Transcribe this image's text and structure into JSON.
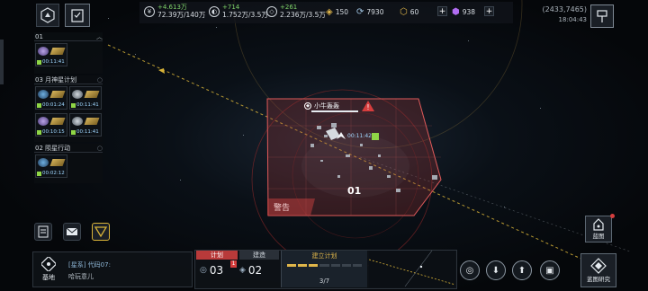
{
  "resources": {
    "credits": {
      "delta": "+4.613万",
      "value": "72.39万/140万"
    },
    "metal": {
      "delta": "+714",
      "value": "1.752万/3.5万"
    },
    "crystal": {
      "delta": "+261",
      "value": "2.236万/3.5万"
    },
    "fuel": "150",
    "energy": "7930",
    "gold": "60",
    "premium": "938"
  },
  "coords": "(2433,7465)",
  "clock": "18:04:43",
  "sections": [
    {
      "title": "01",
      "tasks": [
        {
          "time": "00:11:41"
        }
      ]
    },
    {
      "title": "03 月神星计划",
      "tasks": [
        {
          "time": "00:01:24"
        },
        {
          "time": "00:11:41"
        },
        {
          "time": "00:10:15"
        },
        {
          "time": "00:11:41"
        }
      ]
    },
    {
      "title": "02 陨星行动",
      "tasks": [
        {
          "time": "00:02:12"
        }
      ]
    }
  ],
  "map": {
    "fleet_label": "小牛轰轰",
    "fleet_timer": "00:11:42",
    "zone_warning": "警告",
    "zone_id": "01"
  },
  "chat": {
    "channel": "[星系] 代码07:",
    "message": "哈玩意儿"
  },
  "base_label": "基地",
  "plan": {
    "tab_plan": "计划",
    "tab_build": "建造",
    "plan_count": "03",
    "plan_badge": "1",
    "build_count": "02",
    "create_label": "建立计划",
    "progress": "3/7"
  },
  "blueprint_label": "蓝图",
  "blueprint_research_label": "蓝图研究"
}
